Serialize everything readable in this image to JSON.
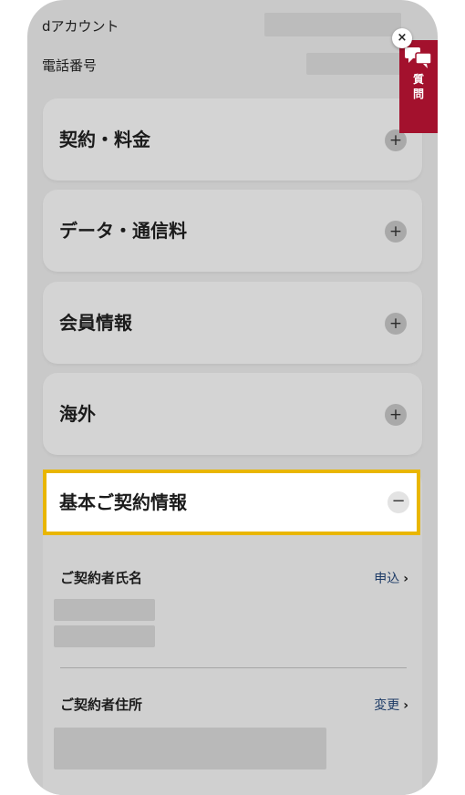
{
  "header": {
    "d_account_label": "dアカウント",
    "phone_number_label": "電話番号"
  },
  "accordion": [
    {
      "label": "契約・料金",
      "icon": "plus-icon"
    },
    {
      "label": "データ・通信料",
      "icon": "plus-icon"
    },
    {
      "label": "会員情報",
      "icon": "plus-icon"
    },
    {
      "label": "海外",
      "icon": "plus-icon"
    }
  ],
  "basic_contract": {
    "label": "基本ご契約情報",
    "icon": "minus-icon",
    "highlight_color": "#e9b600",
    "rows": [
      {
        "label": "ご契約者氏名",
        "link": "申込"
      },
      {
        "label": "ご契約者住所",
        "link": "変更"
      }
    ]
  },
  "question_widget": {
    "char1": "質",
    "char2": "問",
    "close_label": "×",
    "color": "#a3112d",
    "icon": "speech-bubbles-icon"
  },
  "icons": {
    "plus": "+",
    "minus": "−",
    "chevron": "›"
  }
}
